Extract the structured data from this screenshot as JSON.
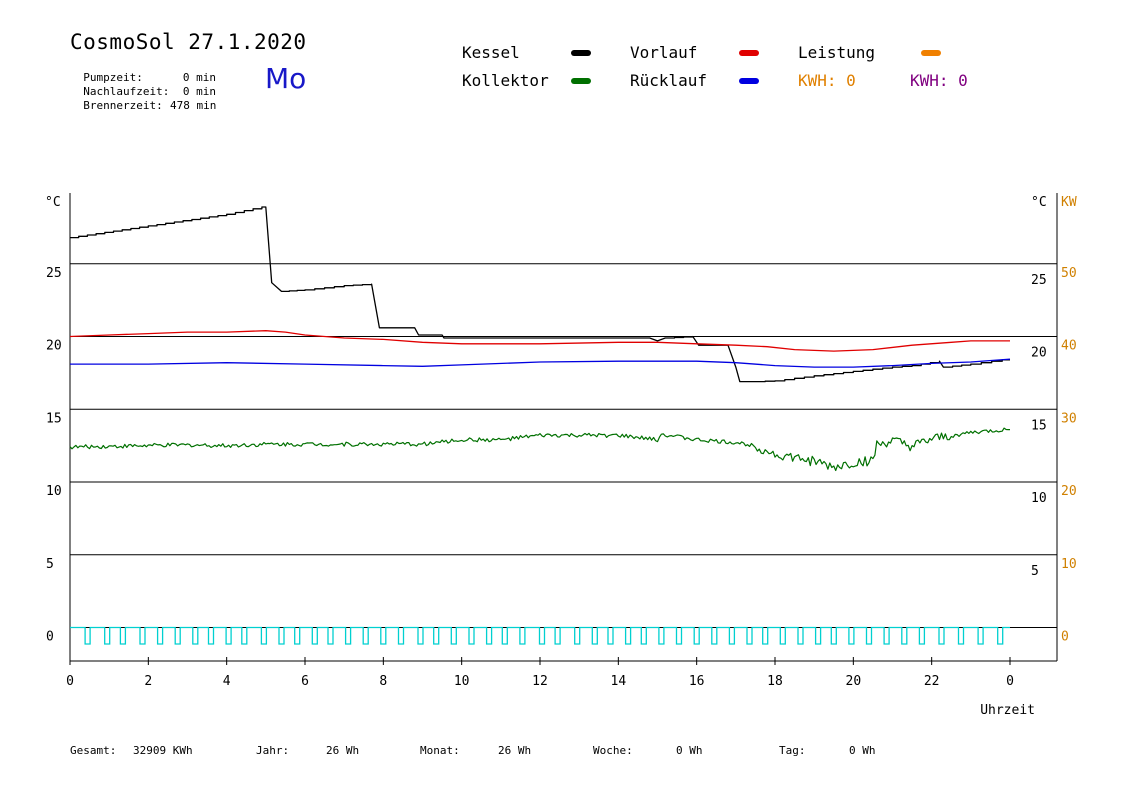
{
  "header": {
    "title": "CosmoSol 27.1.2020",
    "day": "Mo",
    "stats": [
      {
        "label": "Pumpzeit:",
        "value": "0 min"
      },
      {
        "label": "Nachlaufzeit:",
        "value": "0 min"
      },
      {
        "label": "Brennerzeit:",
        "value": "478 min"
      }
    ]
  },
  "legend": {
    "items": [
      {
        "name": "Kessel",
        "color": "#000000"
      },
      {
        "name": "Vorlauf",
        "color": "#e00000"
      },
      {
        "name": "Leistung",
        "color": "#f08000"
      },
      {
        "name": "Kollektor",
        "color": "#007000"
      },
      {
        "name": "Rücklauf",
        "color": "#0000e0"
      }
    ],
    "kwh": [
      {
        "label": "KWH: 0",
        "color": "#e08000"
      },
      {
        "label": "KWH: 0",
        "color": "#800080"
      }
    ]
  },
  "footer": {
    "gesamt_label": "Gesamt:",
    "gesamt_value": "32909 KWh",
    "jahr_label": "Jahr:",
    "jahr_value": "26 Wh",
    "monat_label": "Monat:",
    "monat_value": "26 Wh",
    "woche_label": "Woche:",
    "woche_value": "0 Wh",
    "tag_label": "Tag:",
    "tag_value": "0 Wh"
  },
  "chart_data": {
    "type": "line",
    "xlabel": "Uhrzeit",
    "ylabel_left": "°C",
    "ylabel_right": "°C",
    "ylabel_power": "KW",
    "x_ticks": [
      "0",
      "2",
      "4",
      "6",
      "8",
      "10",
      "12",
      "14",
      "16",
      "18",
      "20",
      "22",
      "0"
    ],
    "y_ticks_left": [
      "0",
      "5",
      "10",
      "15",
      "20",
      "25"
    ],
    "y_ticks_right": [
      "5",
      "10",
      "15",
      "20",
      "25"
    ],
    "y_ticks_power": [
      "0",
      "10",
      "20",
      "30",
      "40",
      "50"
    ],
    "xlim": [
      0,
      24
    ],
    "ylim": [
      -1,
      30
    ],
    "power_ylim": [
      0,
      60
    ],
    "grid": true,
    "series": [
      {
        "name": "Kessel",
        "color": "#000000",
        "step": true,
        "points": [
          [
            0,
            26.8
          ],
          [
            2,
            27.6
          ],
          [
            4,
            28.4
          ],
          [
            4.9,
            28.9
          ],
          [
            5.0,
            28.9
          ],
          [
            5.15,
            23.7
          ],
          [
            5.4,
            23.1
          ],
          [
            6,
            23.2
          ],
          [
            7,
            23.5
          ],
          [
            7.7,
            23.6
          ],
          [
            7.9,
            20.6
          ],
          [
            8,
            20.6
          ],
          [
            8.8,
            20.6
          ],
          [
            8.9,
            20.1
          ],
          [
            9.5,
            20.1
          ],
          [
            9.55,
            19.9
          ],
          [
            12,
            19.9
          ],
          [
            14.8,
            19.9
          ],
          [
            15.0,
            19.7
          ],
          [
            15.2,
            19.9
          ],
          [
            15.9,
            20.0
          ],
          [
            16.05,
            19.4
          ],
          [
            16.8,
            19.4
          ],
          [
            17.0,
            17.9
          ],
          [
            17.1,
            16.9
          ],
          [
            17.5,
            16.9
          ],
          [
            18,
            16.95
          ],
          [
            19,
            17.3
          ],
          [
            20,
            17.6
          ],
          [
            21,
            17.9
          ],
          [
            21.5,
            18.0
          ],
          [
            22.2,
            18.3
          ],
          [
            22.3,
            17.9
          ],
          [
            23,
            18.1
          ],
          [
            23.8,
            18.4
          ],
          [
            24,
            18.4
          ]
        ]
      },
      {
        "name": "Vorlauf",
        "color": "#e00000",
        "points": [
          [
            0,
            20.0
          ],
          [
            1,
            20.1
          ],
          [
            2,
            20.2
          ],
          [
            3,
            20.3
          ],
          [
            4,
            20.3
          ],
          [
            5,
            20.4
          ],
          [
            5.5,
            20.3
          ],
          [
            6,
            20.1
          ],
          [
            7,
            19.9
          ],
          [
            8,
            19.8
          ],
          [
            9,
            19.6
          ],
          [
            10,
            19.5
          ],
          [
            12,
            19.5
          ],
          [
            14,
            19.6
          ],
          [
            15,
            19.6
          ],
          [
            16,
            19.5
          ],
          [
            17,
            19.4
          ],
          [
            17.8,
            19.3
          ],
          [
            18.5,
            19.1
          ],
          [
            19.5,
            19.0
          ],
          [
            20.5,
            19.1
          ],
          [
            21.5,
            19.4
          ],
          [
            22.5,
            19.6
          ],
          [
            23,
            19.7
          ],
          [
            24,
            19.7
          ]
        ]
      },
      {
        "name": "Rücklauf",
        "color": "#0000e0",
        "points": [
          [
            0,
            18.1
          ],
          [
            2,
            18.1
          ],
          [
            4,
            18.2
          ],
          [
            6,
            18.1
          ],
          [
            8,
            18.0
          ],
          [
            9,
            17.95
          ],
          [
            10,
            18.05
          ],
          [
            12,
            18.25
          ],
          [
            14,
            18.3
          ],
          [
            16,
            18.3
          ],
          [
            17,
            18.2
          ],
          [
            18,
            18.0
          ],
          [
            19,
            17.9
          ],
          [
            20,
            17.9
          ],
          [
            21,
            18.0
          ],
          [
            22,
            18.15
          ],
          [
            23,
            18.25
          ],
          [
            24,
            18.45
          ]
        ]
      },
      {
        "name": "Kollektor",
        "color": "#007000",
        "noisy": true,
        "points": [
          [
            0,
            12.4
          ],
          [
            1,
            12.45
          ],
          [
            2,
            12.5
          ],
          [
            3,
            12.55
          ],
          [
            4,
            12.5
          ],
          [
            5,
            12.6
          ],
          [
            6,
            12.6
          ],
          [
            7,
            12.6
          ],
          [
            8,
            12.6
          ],
          [
            9,
            12.6
          ],
          [
            10,
            12.9
          ],
          [
            11,
            12.9
          ],
          [
            12,
            13.2
          ],
          [
            13,
            13.2
          ],
          [
            14,
            13.2
          ],
          [
            15,
            12.9
          ],
          [
            15.1,
            13.3
          ],
          [
            16,
            12.9
          ],
          [
            17,
            12.7
          ],
          [
            17.5,
            12.5
          ],
          [
            18,
            11.9
          ],
          [
            19,
            11.4
          ],
          [
            19.5,
            11.0
          ],
          [
            20,
            11.3
          ],
          [
            20.5,
            11.5
          ],
          [
            20.6,
            12.5
          ],
          [
            21,
            12.8
          ],
          [
            21.5,
            12.4
          ],
          [
            22,
            12.9
          ],
          [
            23,
            13.4
          ],
          [
            24,
            13.6
          ]
        ]
      }
    ],
    "pump": {
      "name": "Pumpe",
      "color": "#00d0d0",
      "high": 0,
      "low": -1,
      "pulses": [
        0.45,
        0.95,
        1.35,
        1.85,
        2.3,
        2.75,
        3.2,
        3.6,
        4.05,
        4.45,
        4.95,
        5.4,
        5.8,
        6.25,
        6.65,
        7.1,
        7.55,
        8.0,
        8.45,
        8.95,
        9.35,
        9.8,
        10.25,
        10.7,
        11.1,
        11.55,
        12.05,
        12.45,
        12.95,
        13.4,
        13.8,
        14.25,
        14.65,
        15.1,
        15.55,
        16.0,
        16.45,
        16.9,
        17.35,
        17.75,
        18.2,
        18.65,
        19.1,
        19.5,
        19.95,
        20.4,
        20.85,
        21.3,
        21.75,
        22.25,
        22.75,
        23.25,
        23.75
      ]
    }
  }
}
